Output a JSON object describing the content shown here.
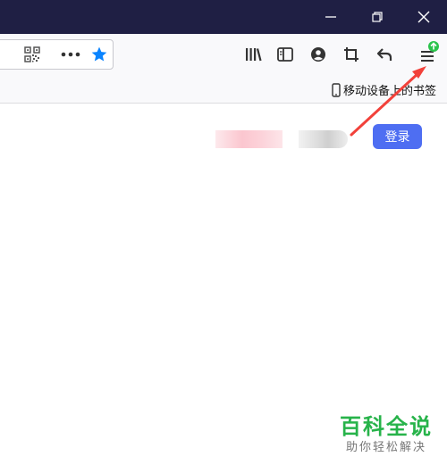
{
  "colors": {
    "titlebar": "#1f1f44",
    "toolbar": "#f9f9fb",
    "star": "#0a84ff",
    "login_button": "#4e6ef2",
    "update_badge": "#2ac34b",
    "annotation_arrow": "#f2413a",
    "watermark": "#27b34a"
  },
  "window_controls": [
    "minimize-icon",
    "restore-icon",
    "close-icon"
  ],
  "urlbar_icons": [
    "qr-code-icon",
    "more-actions-icon",
    "bookmark-star-icon"
  ],
  "toolbar_icons": [
    "library-icon",
    "sidebar-icon",
    "account-icon",
    "screenshot-icon",
    "back-arrow-icon",
    "menu-icon"
  ],
  "bookmarks": {
    "mobile_label": "移动设备上的书签",
    "icon": "phone-icon"
  },
  "page": {
    "login_label": "登录"
  },
  "watermark": {
    "title": "百科全说",
    "subtitle": "助你轻松解决"
  }
}
